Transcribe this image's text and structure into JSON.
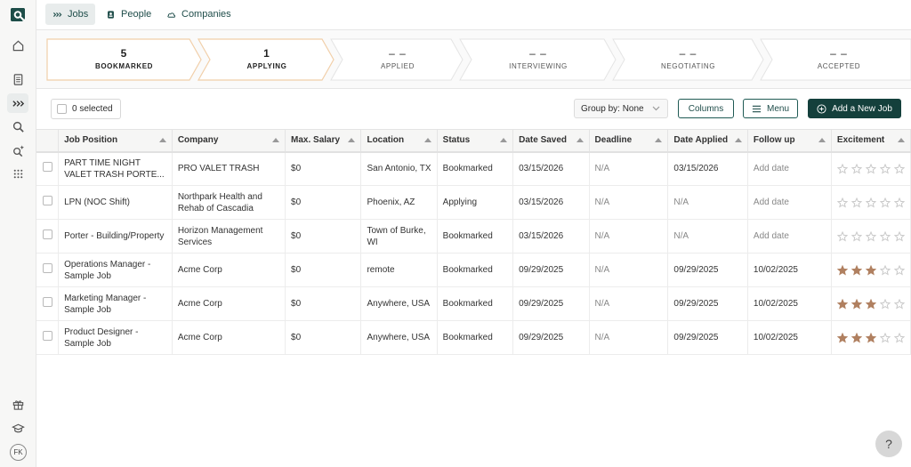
{
  "nav": {
    "tabs": [
      {
        "label": "Jobs",
        "icon": "chevrons-right-icon",
        "active": true
      },
      {
        "label": "People",
        "icon": "contact-card-icon",
        "active": false
      },
      {
        "label": "Companies",
        "icon": "cloud-icon",
        "active": false
      }
    ]
  },
  "sidebar": {
    "icons": [
      "logo-icon",
      "home-icon",
      "document-icon",
      "chevrons-right-icon",
      "search-icon",
      "sparkle-search-icon",
      "grid-icon",
      "gift-icon",
      "graduation-cap-icon"
    ],
    "avatar_initials": "FK"
  },
  "pipeline": {
    "stages": [
      {
        "count": "5",
        "label": "BOOKMARKED"
      },
      {
        "count": "1",
        "label": "APPLYING"
      },
      {
        "count": "– –",
        "label": "APPLIED"
      },
      {
        "count": "– –",
        "label": "INTERVIEWING"
      },
      {
        "count": "– –",
        "label": "NEGOTIATING"
      },
      {
        "count": "– –",
        "label": "ACCEPTED"
      }
    ]
  },
  "toolbar": {
    "selected_label": "0 selected",
    "group_by_label": "Group by: None",
    "columns_label": "Columns",
    "menu_label": "Menu",
    "add_job_label": "Add a New Job"
  },
  "table": {
    "columns": [
      "Job Position",
      "Company",
      "Max. Salary",
      "Location",
      "Status",
      "Date Saved",
      "Deadline",
      "Date Applied",
      "Follow up",
      "Excitement"
    ],
    "rows": [
      {
        "position": "PART TIME NIGHT VALET TRASH PORTE...",
        "company": "PRO VALET TRASH",
        "salary": "$0",
        "location": "San Antonio, TX",
        "status": "Bookmarked",
        "date_saved": "03/15/2026",
        "deadline": "N/A",
        "date_applied": "03/15/2026",
        "follow_up": "Add date",
        "excitement": 0
      },
      {
        "position": "LPN (NOC Shift)",
        "company": "Northpark Health and Rehab of Cascadia",
        "salary": "$0",
        "location": "Phoenix, AZ",
        "status": "Applying",
        "date_saved": "03/15/2026",
        "deadline": "N/A",
        "date_applied": "N/A",
        "follow_up": "Add date",
        "excitement": 0
      },
      {
        "position": "Porter - Building/Property",
        "company": "Horizon Management Services",
        "salary": "$0",
        "location": "Town of Burke, WI",
        "status": "Bookmarked",
        "date_saved": "03/15/2026",
        "deadline": "N/A",
        "date_applied": "N/A",
        "follow_up": "Add date",
        "excitement": 0
      },
      {
        "position": "Operations Manager - Sample Job",
        "company": "Acme Corp",
        "salary": "$0",
        "location": "remote",
        "status": "Bookmarked",
        "date_saved": "09/29/2025",
        "deadline": "N/A",
        "date_applied": "09/29/2025",
        "follow_up": "10/02/2025",
        "excitement": 3
      },
      {
        "position": "Marketing Manager - Sample Job",
        "company": "Acme Corp",
        "salary": "$0",
        "location": "Anywhere, USA",
        "status": "Bookmarked",
        "date_saved": "09/29/2025",
        "deadline": "N/A",
        "date_applied": "09/29/2025",
        "follow_up": "10/02/2025",
        "excitement": 3
      },
      {
        "position": "Product Designer - Sample Job",
        "company": "Acme Corp",
        "salary": "$0",
        "location": "Anywhere, USA",
        "status": "Bookmarked",
        "date_saved": "09/29/2025",
        "deadline": "N/A",
        "date_applied": "09/29/2025",
        "follow_up": "10/02/2025",
        "excitement": 3
      }
    ]
  },
  "help_label": "?",
  "colors": {
    "brand": "#14403c",
    "star_filled": "#b08060",
    "star_empty": "#c9c9c9"
  }
}
